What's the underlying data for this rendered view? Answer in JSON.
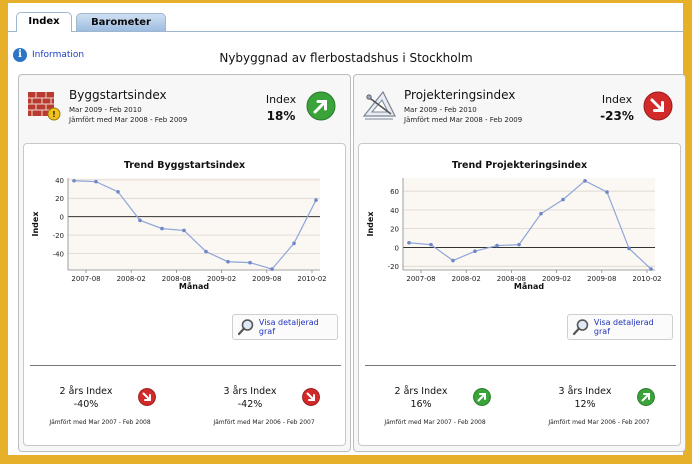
{
  "tabs": [
    {
      "label": "Index",
      "active": true
    },
    {
      "label": "Barometer",
      "active": false
    }
  ],
  "info": {
    "label": "Information",
    "icon": "info-icon"
  },
  "page_title": "Nybyggnad av flerbostadshus i Stockholm",
  "panels": [
    {
      "title": "Byggstartsindex",
      "icon": "brick-wall-icon",
      "period": "Mar 2009 - Feb 2010",
      "compare": "Jämfört med Mar 2008 - Feb 2009",
      "index_label": "Index",
      "index_value": "18%",
      "index_trend": "up",
      "chart_title": "Trend Byggstartsindex",
      "details_label": "Visa detaljerad graf",
      "sub": [
        {
          "label": "2 års Index",
          "value": "-40%",
          "trend": "down",
          "compare": "Jämfört med Mar 2007 - Feb 2008"
        },
        {
          "label": "3 års Index",
          "value": "-42%",
          "trend": "down",
          "compare": "Jämfört med Mar 2006 - Feb 2007"
        }
      ]
    },
    {
      "title": "Projekteringsindex",
      "icon": "drafting-tools-icon",
      "period": "Mar 2009 - Feb 2010",
      "compare": "Jämfört med Mar 2008 - Feb 2009",
      "index_label": "Index",
      "index_value": "-23%",
      "index_trend": "down",
      "chart_title": "Trend Projekteringsindex",
      "details_label": "Visa detaljerad graf",
      "sub": [
        {
          "label": "2 års Index",
          "value": "16%",
          "trend": "up",
          "compare": "Jämfört med Mar 2007 - Feb 2008"
        },
        {
          "label": "3 års Index",
          "value": "12%",
          "trend": "up",
          "compare": "Jämfört med Mar 2006 - Feb 2007"
        }
      ]
    }
  ],
  "colors": {
    "up": "#3aa33a",
    "down": "#d22a2a",
    "line": "#8fa6d9",
    "frame": "#e6b02a"
  },
  "chart_data": [
    {
      "type": "line",
      "title": "Trend Byggstartsindex",
      "xlabel": "Månad",
      "ylabel": "Index",
      "x": [
        "2007-05",
        "2007-07",
        "2007-09",
        "2007-11",
        "2008-01",
        "2008-03",
        "2008-05",
        "2008-07",
        "2008-09",
        "2008-11",
        "2009-01",
        "2009-03",
        "2009-05",
        "2009-07"
      ],
      "series": [
        {
          "values": [
            39,
            38,
            27,
            -4,
            -13,
            -15,
            -38,
            -49,
            -50,
            -57,
            -29,
            18
          ]
        }
      ],
      "xticks": [
        "2007-08",
        "2008-02",
        "2008-08",
        "2009-02",
        "2009-08",
        "2010-02"
      ],
      "yticks": [
        40,
        20,
        0,
        -20,
        -40
      ],
      "ylim": [
        -58,
        42
      ],
      "grid": true
    },
    {
      "type": "line",
      "title": "Trend Projekteringsindex",
      "xlabel": "Månad",
      "ylabel": "Index",
      "series": [
        {
          "values": [
            5,
            3,
            -14,
            -4,
            2,
            3,
            36,
            51,
            71,
            59,
            -1,
            -23
          ]
        }
      ],
      "xticks": [
        "2007-08",
        "2008-02",
        "2008-08",
        "2009-02",
        "2009-08",
        "2010-02"
      ],
      "yticks": [
        60,
        40,
        20,
        0,
        -20
      ],
      "ylim": [
        -24,
        74
      ],
      "grid": true
    }
  ]
}
